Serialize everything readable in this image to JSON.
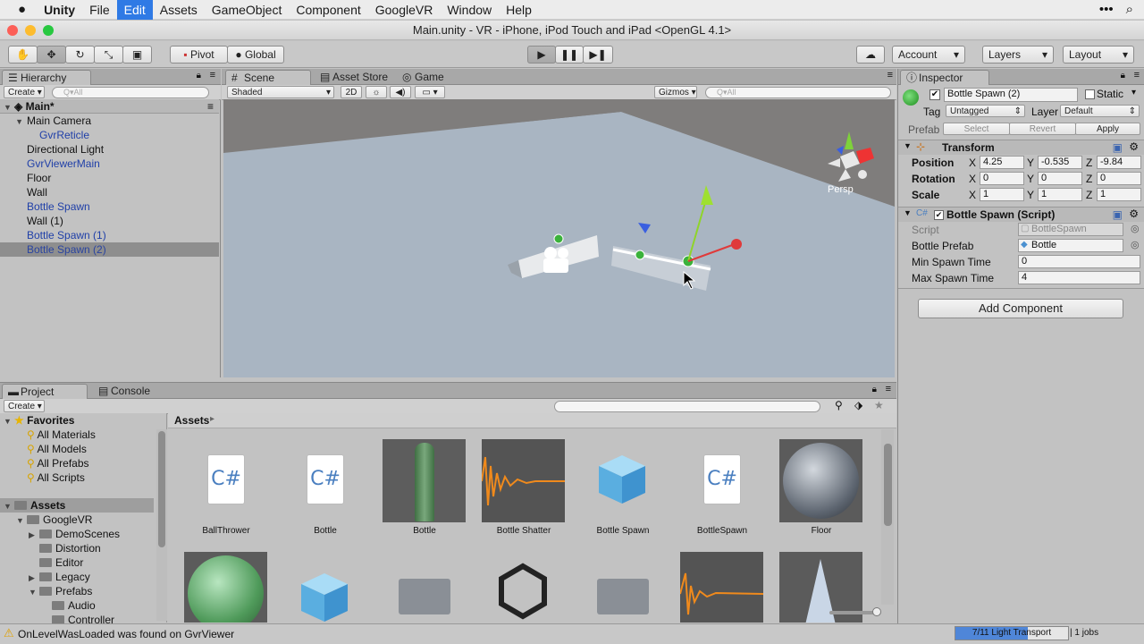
{
  "menubar": {
    "apple": "",
    "items": [
      "Unity",
      "File",
      "Edit",
      "Assets",
      "GameObject",
      "Component",
      "GoogleVR",
      "Window",
      "Help"
    ],
    "active": "Edit"
  },
  "window_title": "Main.unity - VR - iPhone, iPod Touch and iPad <OpenGL 4.1>",
  "toolbar": {
    "pivot": "Pivot",
    "global": "Global",
    "account": "Account",
    "layers": "Layers",
    "layout": "Layout"
  },
  "hierarchy": {
    "tab": "Hierarchy",
    "create": "Create",
    "search_placeholder": "Q▾All",
    "scene": "Main*",
    "items": [
      {
        "label": "Main Camera",
        "indent": 1,
        "expanded": true,
        "style": "normal"
      },
      {
        "label": "GvrReticle",
        "indent": 2,
        "style": "blue"
      },
      {
        "label": "Directional Light",
        "indent": 1,
        "style": "normal"
      },
      {
        "label": "GvrViewerMain",
        "indent": 1,
        "style": "blue"
      },
      {
        "label": "Floor",
        "indent": 1,
        "style": "normal"
      },
      {
        "label": "Wall",
        "indent": 1,
        "style": "normal"
      },
      {
        "label": "Bottle Spawn",
        "indent": 1,
        "style": "blue"
      },
      {
        "label": "Wall (1)",
        "indent": 1,
        "style": "normal"
      },
      {
        "label": "Bottle Spawn (1)",
        "indent": 1,
        "style": "blue"
      },
      {
        "label": "Bottle Spawn (2)",
        "indent": 1,
        "style": "selected"
      }
    ]
  },
  "scene_view": {
    "tabs": [
      "Scene",
      "Asset Store",
      "Game"
    ],
    "shading": "Shaded",
    "mode_2d": "2D",
    "gizmos": "Gizmos",
    "search_placeholder": "Q▾All",
    "persp": "Persp"
  },
  "inspector": {
    "tab": "Inspector",
    "object_name": "Bottle Spawn (2)",
    "static_label": "Static",
    "tag_label": "Tag",
    "tag_value": "Untagged",
    "layer_label": "Layer",
    "layer_value": "Default",
    "prefab_label": "Prefab",
    "prefab_buttons": [
      "Select",
      "Revert",
      "Apply"
    ],
    "transform": {
      "title": "Transform",
      "rows": [
        {
          "label": "Position",
          "x": "4.25",
          "y": "-0.535",
          "z": "-9.84"
        },
        {
          "label": "Rotation",
          "x": "0",
          "y": "0",
          "z": "0"
        },
        {
          "label": "Scale",
          "x": "1",
          "y": "1",
          "z": "1"
        }
      ]
    },
    "script": {
      "title": "Bottle Spawn (Script)",
      "fields": [
        {
          "label": "Script",
          "value": "BottleSpawn",
          "muted": true
        },
        {
          "label": "Bottle Prefab",
          "value": "Bottle",
          "muted": false
        },
        {
          "label": "Min Spawn Time",
          "value": "0",
          "muted": false
        },
        {
          "label": "Max Spawn Time",
          "value": "4",
          "muted": false
        }
      ]
    },
    "add_component": "Add Component"
  },
  "project": {
    "tabs": [
      "Project",
      "Console"
    ],
    "create": "Create",
    "favorites_title": "Favorites",
    "favorites": [
      "All Materials",
      "All Models",
      "All Prefabs",
      "All Scripts"
    ],
    "assets_title": "Assets",
    "tree": [
      {
        "label": "GoogleVR",
        "indent": 1,
        "expanded": true
      },
      {
        "label": "DemoScenes",
        "indent": 2,
        "collapsed": true
      },
      {
        "label": "Distortion",
        "indent": 2
      },
      {
        "label": "Editor",
        "indent": 2
      },
      {
        "label": "Legacy",
        "indent": 2,
        "collapsed": true
      },
      {
        "label": "Prefabs",
        "indent": 2,
        "expanded": true
      },
      {
        "label": "Audio",
        "indent": 3
      },
      {
        "label": "Controller",
        "indent": 3
      }
    ],
    "breadcrumb": "Assets",
    "grid": [
      {
        "label": "BallThrower",
        "kind": "script"
      },
      {
        "label": "Bottle",
        "kind": "script"
      },
      {
        "label": "Bottle",
        "kind": "model"
      },
      {
        "label": "Bottle Shatter",
        "kind": "audio"
      },
      {
        "label": "Bottle Spawn",
        "kind": "prefab"
      },
      {
        "label": "BottleSpawn",
        "kind": "script"
      },
      {
        "label": "Floor",
        "kind": "material"
      }
    ]
  },
  "status": {
    "message": "OnLevelWasLoaded was found on GvrViewer",
    "progress_label": "7/11 Light Transport",
    "progress_fraction": 0.64,
    "jobs": "1 jobs"
  }
}
